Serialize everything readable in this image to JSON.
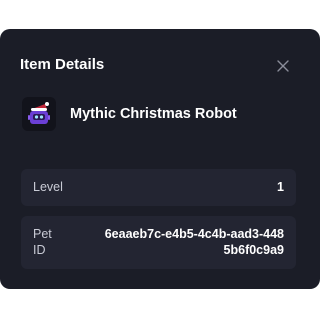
{
  "modal": {
    "title": "Item Details",
    "close_icon": "close-icon"
  },
  "item": {
    "name": "Mythic Christmas Robot",
    "thumbnail_icon": "christmas-robot-icon"
  },
  "fields": {
    "level": {
      "label": "Level",
      "value": "1"
    },
    "pet_id": {
      "label": "Pet ID",
      "value": "6eaaeb7c-e4b5-4c4b-aad3-4485b6f0c9a9"
    }
  },
  "colors": {
    "modal_bg": "#1b1d27",
    "field_bg": "#232532",
    "robot_purple": "#6b3fd6",
    "hat_red": "#c0283a"
  }
}
